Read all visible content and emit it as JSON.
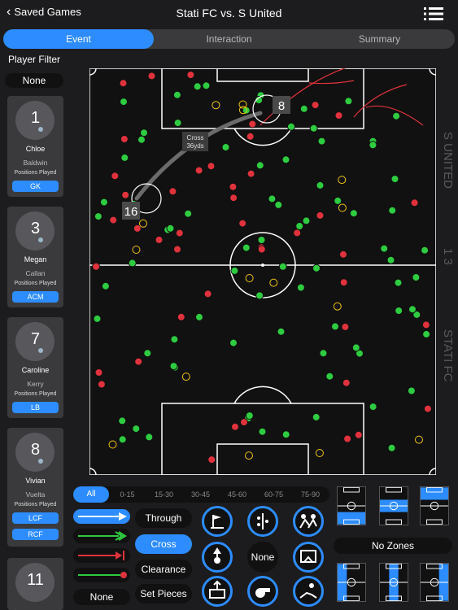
{
  "nav": {
    "back_label": "Saved Games",
    "title": "Stati FC vs. S United"
  },
  "tabs": [
    {
      "label": "Event",
      "active": true
    },
    {
      "label": "Interaction",
      "active": false
    },
    {
      "label": "Summary",
      "active": false
    }
  ],
  "sidebar": {
    "filter_title": "Player Filter",
    "filter_value": "None",
    "positions_label": "Positions Played",
    "players": [
      {
        "number": "1",
        "first": "Chloe",
        "last": "Baldwin",
        "positions": [
          "GK"
        ]
      },
      {
        "number": "3",
        "first": "Megan",
        "last": "Callan",
        "positions": [
          "ACM"
        ]
      },
      {
        "number": "7",
        "first": "Caroline",
        "last": "Kerry",
        "positions": [
          "LB"
        ]
      },
      {
        "number": "8",
        "first": "Vivian",
        "last": "Vuelta",
        "positions": [
          "LCF",
          "RCF"
        ]
      },
      {
        "number": "11",
        "first": "",
        "last": "",
        "positions": []
      }
    ]
  },
  "field": {
    "highlight_start": "16",
    "highlight_end": "8",
    "cross_label_1": "Cross",
    "cross_label_2": "36yds",
    "side_label_top": "S UNITED",
    "side_label_score": "1   3",
    "side_label_bottom": "STATI FC"
  },
  "time_filters": [
    "All",
    "0-15",
    "15-30",
    "30-45",
    "45-60",
    "60-75",
    "75-90"
  ],
  "type_buttons": [
    "Through",
    "Cross",
    "Clearance",
    "Set Pieces"
  ],
  "active_type": "Cross",
  "none_btn": "None",
  "center_none": "None",
  "zones_label": "No Zones",
  "icons": [
    "corner-flag-icon",
    "formation-icon",
    "tackle-icon",
    "header-icon",
    "save-icon",
    "goal-kick-icon",
    "whistle-icon",
    "slide-icon"
  ]
}
